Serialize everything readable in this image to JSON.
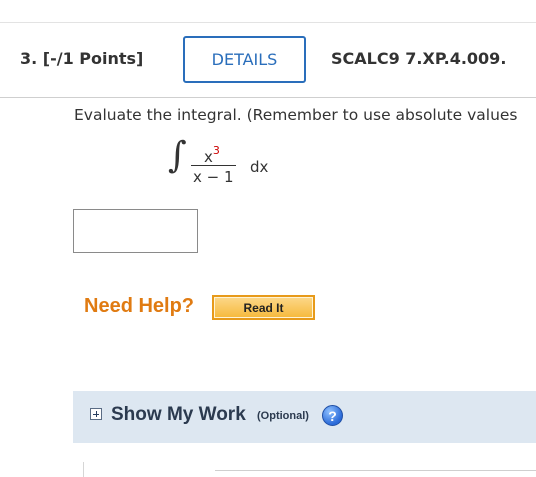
{
  "question": {
    "number_points": "3.  [-/1 Points]",
    "details_label": "DETAILS",
    "code": "SCALC9 7.XP.4.009."
  },
  "prompt": "Evaluate the integral. (Remember to use absolute values",
  "integral": {
    "sign": "∫",
    "numerator_base": "x",
    "numerator_exp": "3",
    "denominator": "x − 1",
    "differential": "dx"
  },
  "answer": {
    "value": ""
  },
  "help": {
    "label": "Need Help?",
    "read_it_label": "Read It"
  },
  "show_work": {
    "label": "Show My Work",
    "optional": "(Optional)",
    "help_glyph": "?"
  },
  "colors": {
    "details_accent": "#2a6ebb",
    "need_help": "#e07b12",
    "panel_bg": "#dde7f1",
    "exponent": "#cc0000"
  },
  "icons": [
    "expand-icon",
    "help-icon"
  ]
}
